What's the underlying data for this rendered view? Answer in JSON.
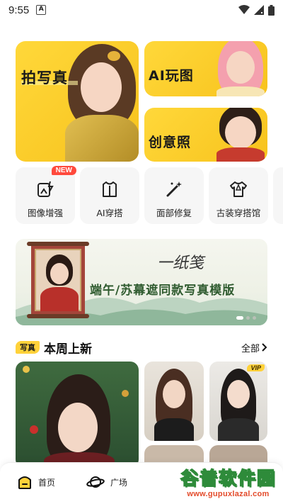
{
  "status_bar": {
    "time": "9:55",
    "notification_icon": "A"
  },
  "hero": {
    "photo": {
      "title": "拍写真"
    },
    "ai_play": {
      "title": "AI玩图"
    },
    "creative": {
      "title": "创意照"
    }
  },
  "tools": [
    {
      "label": "图像增强",
      "icon": "image-enhance-icon",
      "badge": "NEW"
    },
    {
      "label": "AI穿搭",
      "icon": "outfit-icon"
    },
    {
      "label": "面部修复",
      "icon": "magic-wand-icon"
    },
    {
      "label": "古装穿搭馆",
      "icon": "costume-icon"
    }
  ],
  "banner": {
    "calligraphy": "一纸笺",
    "text": "端午/苏幕遮同款写真模版"
  },
  "section": {
    "tag": "写真",
    "title": "本周上新",
    "all": "全部"
  },
  "gallery": {
    "vip_badge": "VIP"
  },
  "nav": {
    "home": "首页",
    "square": "广场"
  },
  "watermark": {
    "name": "谷普软件园",
    "url": "www.gupuxlazal.com"
  },
  "colors": {
    "accent_yellow": "#ffd23a",
    "badge_red": "#ff4a3d",
    "watermark_green": "#2e8b3a"
  }
}
